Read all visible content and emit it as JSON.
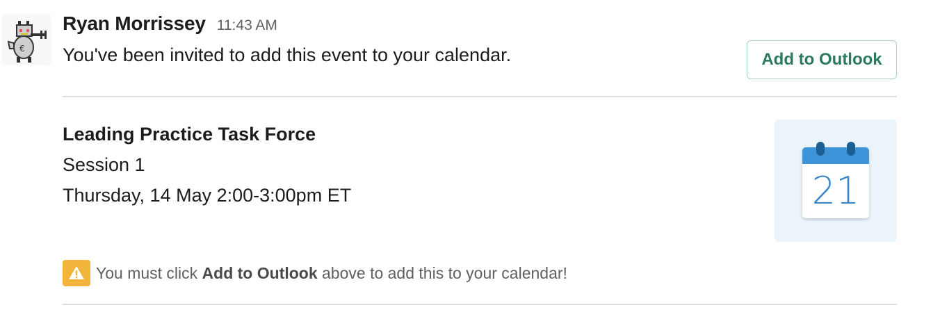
{
  "message": {
    "sender": "Ryan Morrissey",
    "timestamp": "11:43 AM",
    "intro": "You've been invited to add this event to your calendar."
  },
  "action": {
    "add_to_outlook_label": "Add to Outlook"
  },
  "event": {
    "title": "Leading Practice Task Force",
    "session": "Session 1",
    "datetime": "Thursday, 14 May 2:00-3:00pm ET",
    "calendar_day": "21"
  },
  "notice": {
    "prefix": "You must click ",
    "emphasis": "Add to Outlook",
    "suffix": " above to add this to your calendar!"
  },
  "icons": {
    "avatar": "robot-avatar",
    "calendar": "calendar-icon",
    "warning": "warning-icon"
  },
  "colors": {
    "button_text": "#2a7a5c",
    "button_border": "#a7d1c1",
    "calendar_card_bg": "#eaf4fa",
    "calendar_band": "#3e94d8",
    "warning": "#f2b43a",
    "muted_text": "#616061"
  }
}
